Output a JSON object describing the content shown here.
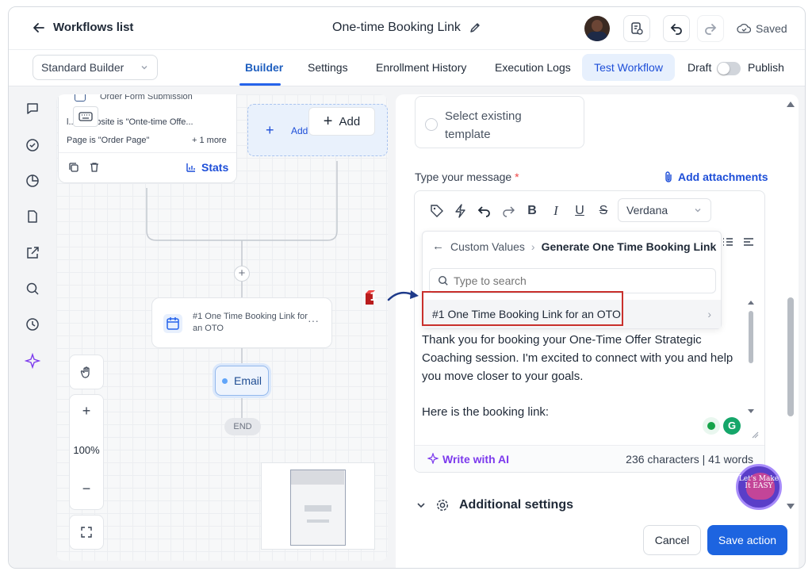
{
  "header": {
    "back_label": "Workflows list",
    "workflow_title": "One-time Booking Link",
    "save_status": "Saved"
  },
  "subbar": {
    "builder_select": "Standard Builder",
    "tabs": [
      "Builder",
      "Settings",
      "Enrollment History",
      "Execution Logs"
    ],
    "test_workflow": "Test Workflow",
    "draft_label": "Draft",
    "publish_label": "Publish"
  },
  "sidebar": {
    "icons": [
      "chat-icon",
      "check-circle-icon",
      "pie-chart-icon",
      "document-icon",
      "external-link-icon",
      "search-icon",
      "history-icon",
      "sparkle-icon"
    ]
  },
  "canvas": {
    "trigger_card": {
      "title": "Order Form Submission",
      "filter1": "l...ol/website is \"Onte-time Offe...",
      "filter2": "Page is \"Order Page\"",
      "more": "+ 1 more",
      "stats": "Stats"
    },
    "add_card": {
      "add_label": "Add",
      "add_overlay": "Add"
    },
    "action_node": {
      "title": "#1 One Time Booking Link for an OTO"
    },
    "email_node": "Email",
    "end_node": "END",
    "zoom_level": "100%"
  },
  "panel": {
    "template_option": "Select existing template",
    "message_label": "Type your message",
    "required_mark": "*",
    "attachments": "Add attachments",
    "font": "Verdana",
    "dropdown": {
      "crumb_parent": "Custom Values",
      "crumb_current": "Generate One Time Booking Link",
      "search_placeholder": "Type to search",
      "item": "#1 One Time Booking Link for an OTO"
    },
    "message_paragraphs": [
      "Thank you for booking your One-Time Offer Strategic Coaching session. I'm excited to connect with you and help you move closer to your goals.",
      "Here is the booking link:"
    ],
    "write_ai": "Write with AI",
    "char_count": "236 characters | 41 words",
    "additional_settings": "Additional settings",
    "cancel": "Cancel",
    "save_action": "Save action"
  },
  "annotation": {
    "step_number": "1"
  },
  "watermark": {
    "text": "Let's Make It EASY"
  },
  "colors": {
    "accent": "#1d64e0",
    "highlight_box": "#c9302c",
    "ai_purple": "#7c3aed"
  }
}
